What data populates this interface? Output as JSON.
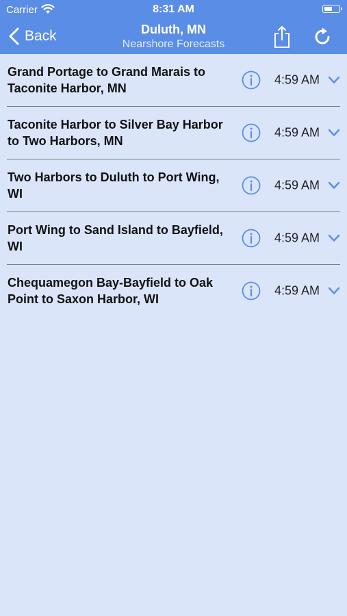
{
  "status_bar": {
    "carrier": "Carrier",
    "time": "8:31 AM"
  },
  "nav": {
    "back_label": "Back",
    "title": "Duluth, MN",
    "subtitle": "Nearshore Forecasts"
  },
  "colors": {
    "accent": "#5a8de6",
    "background": "#dae5fa",
    "icon_blue": "#5a8de6"
  },
  "icons": [
    "wifi-icon",
    "battery-icon",
    "chevron-left-icon",
    "share-icon",
    "refresh-icon",
    "info-icon",
    "chevron-down-icon"
  ],
  "forecasts": [
    {
      "name": "Grand Portage to Grand Marais to Taconite Harbor, MN",
      "time": "4:59 AM"
    },
    {
      "name": "Taconite Harbor to Silver Bay Harbor to Two Harbors, MN",
      "time": "4:59 AM"
    },
    {
      "name": "Two Harbors to Duluth to Port Wing, WI",
      "time": "4:59 AM"
    },
    {
      "name": "Port Wing to Sand Island to Bayfield, WI",
      "time": "4:59 AM"
    },
    {
      "name": "Chequamegon Bay-Bayfield to Oak Point to Saxon Harbor, WI",
      "time": "4:59 AM"
    }
  ]
}
